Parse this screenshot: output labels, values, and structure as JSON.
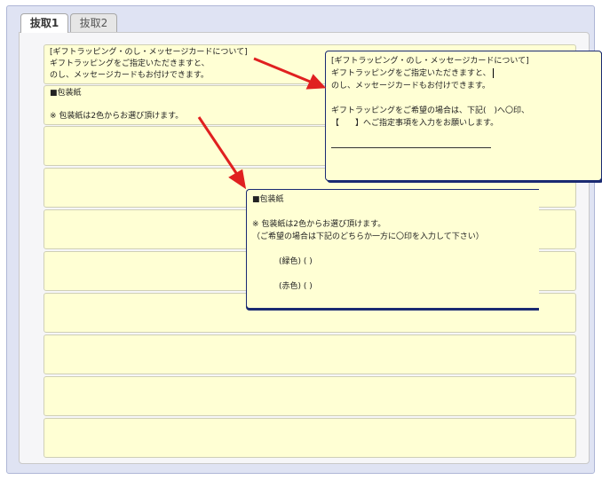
{
  "tabs": [
    {
      "label": "抜取1",
      "active": true
    },
    {
      "label": "抜取2",
      "active": false
    }
  ],
  "cells": [
    {
      "lines": [
        "[ギフトラッピング・のし・メッセージカードについて]",
        "ギフトラッピングをご指定いただきますと、",
        "のし、メッセージカードもお付けできます。"
      ]
    },
    {
      "lines": [
        "■包装紙",
        "",
        "※ 包装紙は2色からお選び頂けます。"
      ]
    },
    {
      "lines": []
    },
    {
      "lines": []
    },
    {
      "lines": []
    },
    {
      "lines": []
    },
    {
      "lines": []
    },
    {
      "lines": []
    },
    {
      "lines": []
    },
    {
      "lines": []
    }
  ],
  "popup_gift": {
    "lines": [
      "[ギフトラッピング・のし・メッセージカードについて]",
      "ギフトラッピングをご指定いただきますと、",
      "のし、メッセージカードもお付けできます。",
      "",
      "ギフトラッピングをご希望の場合は、下記(　)へ〇印、",
      "【　　】へご指定事項を入力をお願いします。"
    ]
  },
  "popup_wrap": {
    "lines": [
      "■包装紙",
      "",
      "※ 包装紙は2色からお選び頂けます。",
      "（ご希望の場合は下記のどちらか一方に〇印を入力して下さい）",
      "",
      "(緑色) (  )",
      "",
      "(赤色) (  )"
    ]
  },
  "colors": {
    "cell_bg": "#ffffd4",
    "popup_border": "#1a2a72",
    "arrow": "#e02020",
    "frame_bg": "#dfe3f3"
  }
}
